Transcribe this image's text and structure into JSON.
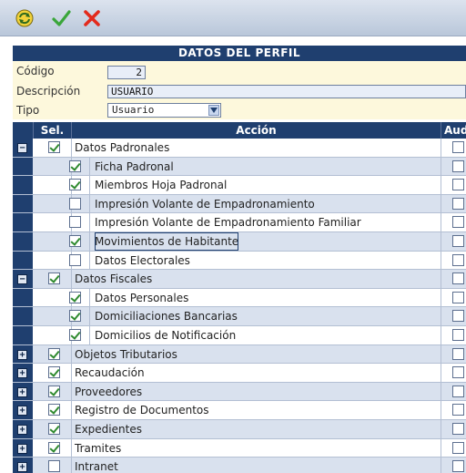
{
  "toolbar": {
    "refresh_icon": "refresh-icon",
    "accept_icon": "checkmark-icon",
    "cancel_icon": "close-icon",
    "accept_color": "#3aa63a",
    "cancel_color": "#e32a1c"
  },
  "section_title": "DATOS DEL PERFIL",
  "form": {
    "codigo_label": "Código",
    "codigo_value": "2",
    "descripcion_label": "Descripción",
    "descripcion_value": "USUARIO",
    "tipo_label": "Tipo",
    "tipo_value": "Usuario"
  },
  "grid": {
    "headers": {
      "sel": "Sel.",
      "accion": "Acción",
      "aud": "Aud"
    },
    "rows": [
      {
        "label": "Datos Padronales",
        "level": 0,
        "expander": "−",
        "sel": true,
        "aud": false
      },
      {
        "label": "Ficha Padronal",
        "level": 1,
        "sel": true,
        "aud": false
      },
      {
        "label": "Miembros Hoja Padronal",
        "level": 1,
        "sel": true,
        "aud": false
      },
      {
        "label": "Impresión Volante de Empadronamiento",
        "level": 1,
        "sel": false,
        "aud": false
      },
      {
        "label": "Impresión Volante de Empadronamiento Familiar",
        "level": 1,
        "sel": false,
        "aud": false
      },
      {
        "label": "Movimientos de Habitante",
        "level": 1,
        "sel": true,
        "aud": false,
        "selected": true
      },
      {
        "label": "Datos Electorales",
        "level": 1,
        "sel": false,
        "aud": false
      },
      {
        "label": "Datos Fiscales",
        "level": 0,
        "expander": "−",
        "sel": true,
        "aud": false
      },
      {
        "label": "Datos Personales",
        "level": 1,
        "sel": true,
        "aud": false
      },
      {
        "label": "Domiciliaciones Bancarias",
        "level": 1,
        "sel": true,
        "aud": false
      },
      {
        "label": "Domicilios de Notificación",
        "level": 1,
        "sel": true,
        "aud": false
      },
      {
        "label": "Objetos Tributarios",
        "level": 0,
        "expander": "+",
        "sel": true,
        "aud": false
      },
      {
        "label": "Recaudación",
        "level": 0,
        "expander": "+",
        "sel": true,
        "aud": false
      },
      {
        "label": "Proveedores",
        "level": 0,
        "expander": "+",
        "sel": true,
        "aud": false
      },
      {
        "label": "Registro de Documentos",
        "level": 0,
        "expander": "+",
        "sel": true,
        "aud": false
      },
      {
        "label": "Expedientes",
        "level": 0,
        "expander": "+",
        "sel": true,
        "aud": false
      },
      {
        "label": "Tramites",
        "level": 0,
        "expander": "+",
        "sel": true,
        "aud": false
      },
      {
        "label": "Intranet",
        "level": 0,
        "expander": "+",
        "sel": false,
        "aud": false
      }
    ]
  }
}
